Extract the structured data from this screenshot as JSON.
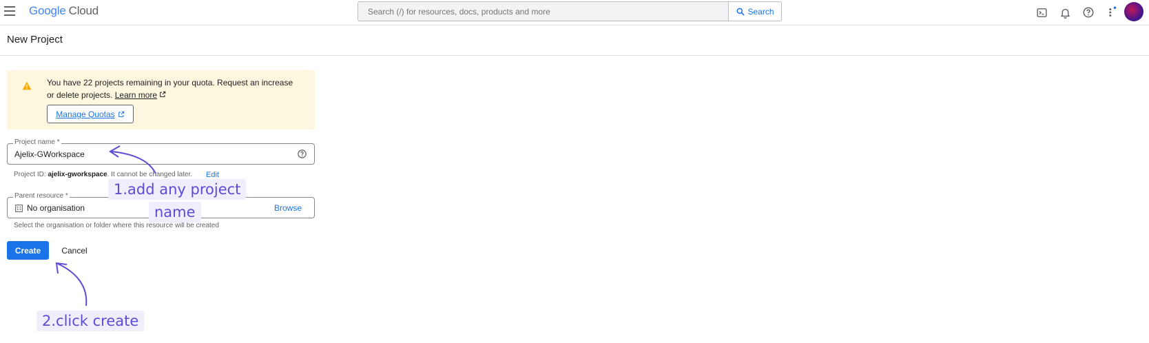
{
  "header": {
    "logo_google": "Google",
    "logo_cloud": "Cloud",
    "search_placeholder": "Search (/) for resources, docs, products and more",
    "search_button": "Search",
    "icons": [
      "menu-icon",
      "search-icon",
      "cloud-shell-icon",
      "notifications-icon",
      "help-icon",
      "more-vert-icon",
      "avatar"
    ]
  },
  "page": {
    "title": "New Project"
  },
  "quota_notice": {
    "message": "You have 22 projects remaining in your quota. Request an increase or delete projects.",
    "learn_more": "Learn more",
    "manage_button": "Manage Quotas"
  },
  "form": {
    "project_name": {
      "label": "Project name *",
      "value": "Ajelix-GWorkspace",
      "id_prefix": "Project ID: ",
      "id_value": "ajelix-gworkspace",
      "id_suffix": ". It cannot be changed later.",
      "edit_label": "Edit"
    },
    "parent_resource": {
      "label": "Parent resource *",
      "value": "No organisation",
      "browse_label": "Browse",
      "helper": "Select the organisation or folder where this resource will be created"
    },
    "create_label": "Create",
    "cancel_label": "Cancel"
  },
  "annotations": {
    "step1_line1": "1.add any project",
    "step1_line2": "name",
    "step2": "2.click create"
  },
  "colors": {
    "primary": "#1a73e8",
    "warning_bg": "#fef7e0",
    "warning_icon": "#f9ab00",
    "annotation": "#5b4cd6",
    "annotation_bg": "#f0edfc"
  }
}
